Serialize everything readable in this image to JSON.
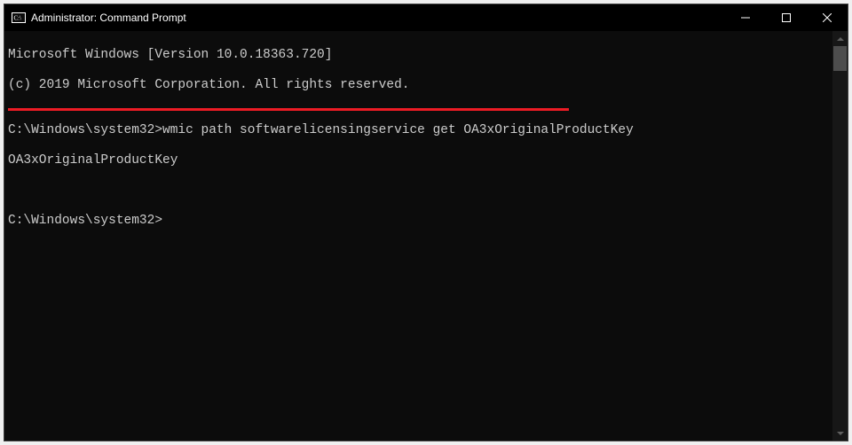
{
  "titlebar": {
    "title": "Administrator: Command Prompt"
  },
  "terminal": {
    "line1": "Microsoft Windows [Version 10.0.18363.720]",
    "line2": "(c) 2019 Microsoft Corporation. All rights reserved.",
    "blank1": "",
    "prompt1_path": "C:\\Windows\\system32>",
    "prompt1_cmd": "wmic path softwarelicensingservice get OA3xOriginalProductKey",
    "output_header": "OA3xOriginalProductKey",
    "blank2": "",
    "blank3": "",
    "prompt2_path": "C:\\Windows\\system32>"
  }
}
